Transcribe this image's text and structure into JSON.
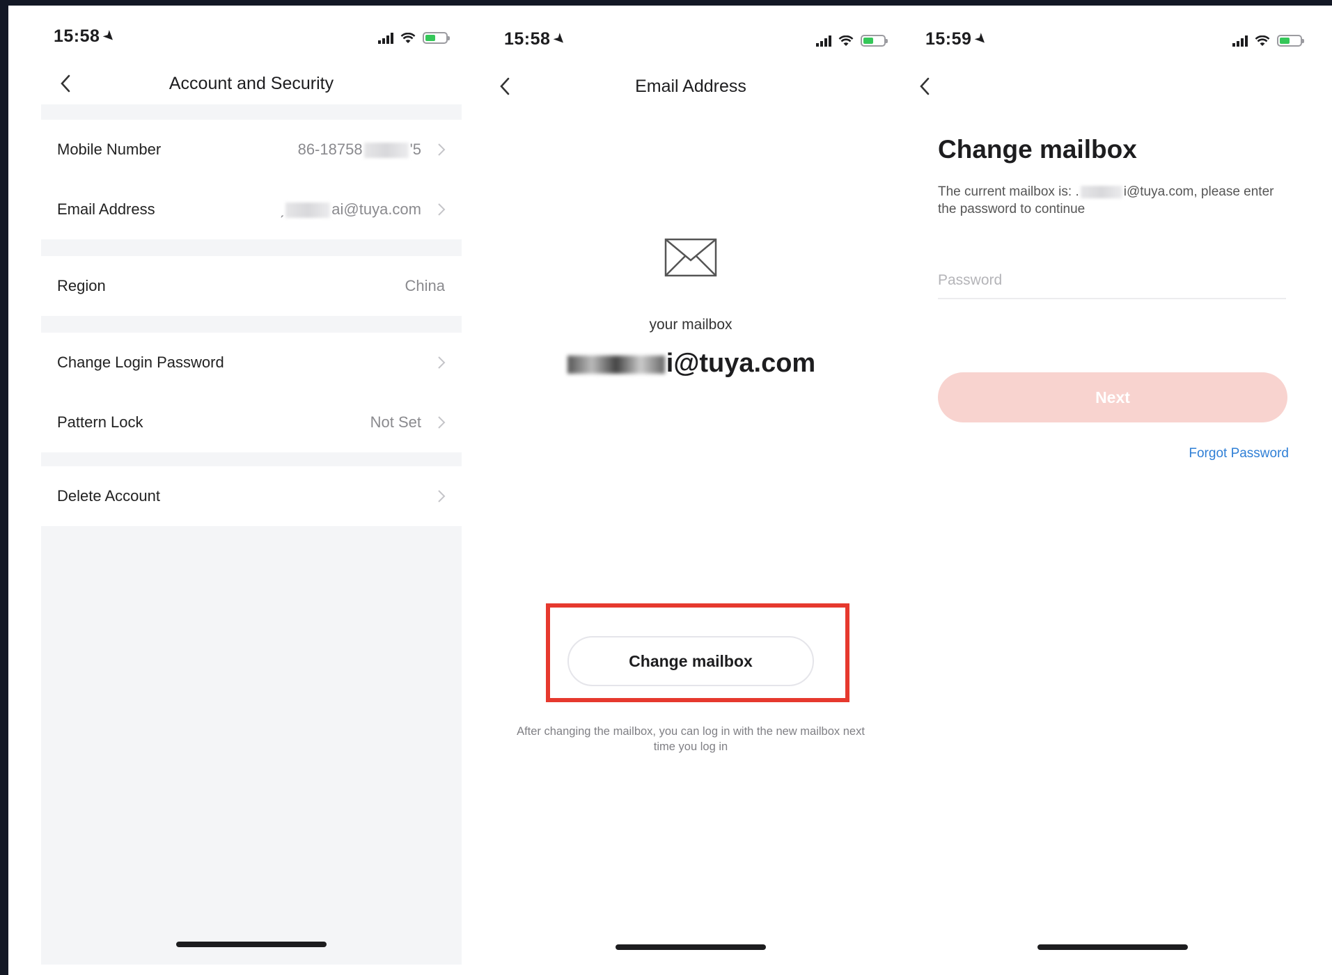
{
  "screen_account": {
    "time": "15:58",
    "title": "Account and Security",
    "mobile_label": "Mobile Number",
    "mobile_value_prefix": "86-18758",
    "mobile_value_suffix": "'5",
    "email_label": "Email Address",
    "email_value_prefix": "ˏ",
    "email_value_suffix": "ai@tuya.com",
    "region_label": "Region",
    "region_value": "China",
    "change_password_label": "Change Login Password",
    "pattern_lock_label": "Pattern Lock",
    "pattern_lock_value": "Not Set",
    "delete_account_label": "Delete Account"
  },
  "screen_email": {
    "time": "15:58",
    "title": "Email Address",
    "your_mailbox_label": "your mailbox",
    "mailbox_suffix": "i@tuya.com",
    "change_mailbox_button": "Change mailbox",
    "hint": "After changing the mailbox, you can log in with the new mailbox next time you log in"
  },
  "screen_change": {
    "time": "15:59",
    "title": "Change mailbox",
    "desc_prefix": "The current mailbox is: .",
    "desc_suffix": "i@tuya.com, please enter the password to continue",
    "password_placeholder": "Password",
    "next_button": "Next",
    "forgot_password": "Forgot Password"
  },
  "icons": {
    "back": "chevron-left-icon",
    "row_arrow": "chevron-right-icon",
    "mail": "envelope-icon",
    "location": "location-arrow-icon",
    "signal": "cellular-signal-icon",
    "wifi": "wifi-icon",
    "battery": "battery-charging-icon"
  },
  "colors": {
    "highlight": "#e6392e",
    "next_button_disabled": "#f8d3cf",
    "link": "#2f7fd6",
    "battery": "#35c759"
  }
}
